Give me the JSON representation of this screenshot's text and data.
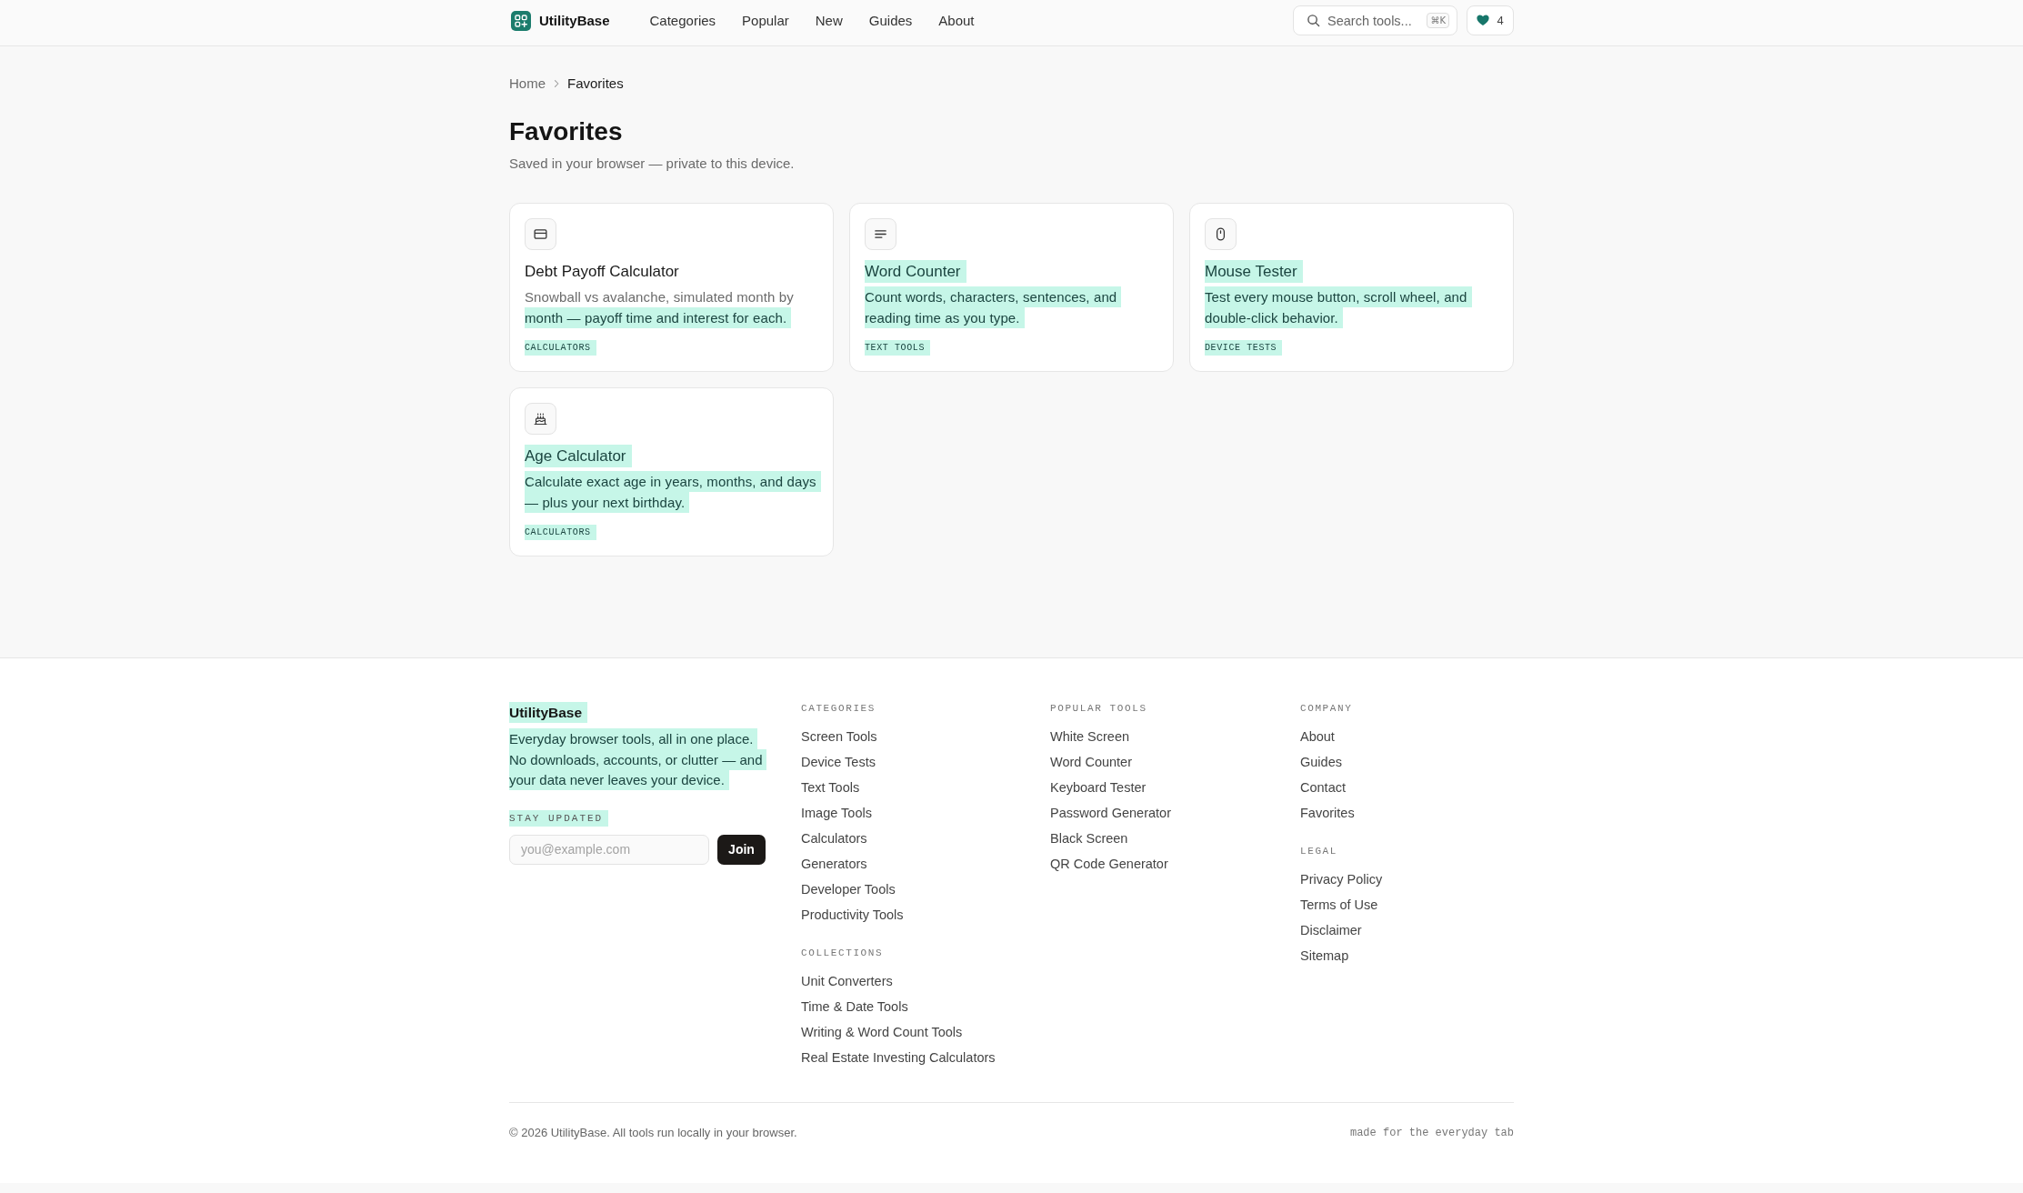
{
  "header": {
    "brand": "UtilityBase",
    "nav": [
      "Categories",
      "Popular",
      "New",
      "Guides",
      "About"
    ],
    "search": {
      "label": "Search tools...",
      "shortcut": "⌘K"
    },
    "favorites_count": "4"
  },
  "breadcrumb": [
    {
      "label": "Home",
      "current": false
    },
    {
      "label": "Favorites",
      "current": true
    }
  ],
  "page": {
    "title": "Favorites",
    "subtitle": "Saved in your browser — private to this device."
  },
  "cards": [
    {
      "title": "Debt Payoff Calculator",
      "title_highlighted": false,
      "description": [
        {
          "text": "Snowball vs avalanche, simulated month by ",
          "highlighted": false
        },
        {
          "text": "month — payoff time and interest for each.",
          "highlighted": true
        }
      ],
      "tag": "CALCULATORS",
      "tag_highlighted": true
    },
    {
      "title": "Word Counter",
      "title_highlighted": true,
      "description": [
        {
          "text": "Count words, characters, sentences, and reading time as you type.",
          "highlighted": true
        }
      ],
      "tag": "TEXT TOOLS",
      "tag_highlighted": true
    },
    {
      "title": "Mouse Tester",
      "title_highlighted": true,
      "description": [
        {
          "text": "Test every mouse button, scroll wheel, and double-click behavior.",
          "highlighted": true
        }
      ],
      "tag": "DEVICE TESTS",
      "tag_highlighted": true
    },
    {
      "title": "Age Calculator",
      "title_highlighted": true,
      "description": [
        {
          "text": "Calculate exact age in years, months, and days — plus your next birthday.",
          "highlighted": true
        }
      ],
      "tag": "CALCULATORS",
      "tag_highlighted": true
    }
  ],
  "footer": {
    "brand": {
      "text": "UtilityBase",
      "highlighted": true
    },
    "tagline": {
      "text": "Everyday browser tools, all in one place. No downloads, accounts, or clutter — and your data never leaves your device.",
      "highlighted": true
    },
    "newsletter": {
      "label": "STAY UPDATED",
      "label_highlighted": true,
      "placeholder": "you@example.com",
      "button": "Join"
    },
    "columns": [
      {
        "sections": [
          {
            "heading": "CATEGORIES",
            "links": [
              "Screen Tools",
              "Device Tests",
              "Text Tools",
              "Image Tools",
              "Calculators",
              "Generators",
              "Developer Tools",
              "Productivity Tools"
            ]
          },
          {
            "heading": "COLLECTIONS",
            "links": [
              "Unit Converters",
              "Time & Date Tools",
              "Writing & Word Count Tools",
              "Real Estate Investing Calculators"
            ]
          }
        ]
      },
      {
        "sections": [
          {
            "heading": "POPULAR TOOLS",
            "links": [
              "White Screen",
              "Word Counter",
              "Keyboard Tester",
              "Password Generator",
              "Black Screen",
              "QR Code Generator"
            ]
          }
        ]
      },
      {
        "sections": [
          {
            "heading": "COMPANY",
            "links": [
              "About",
              "Guides",
              "Contact",
              "Favorites"
            ]
          },
          {
            "heading": "LEGAL",
            "links": [
              "Privacy Policy",
              "Terms of Use",
              "Disclaimer",
              "Sitemap"
            ]
          }
        ]
      }
    ],
    "copyright": "© 2026 UtilityBase. All tools run locally in your browser.",
    "motto": "made for the everyday tab"
  }
}
